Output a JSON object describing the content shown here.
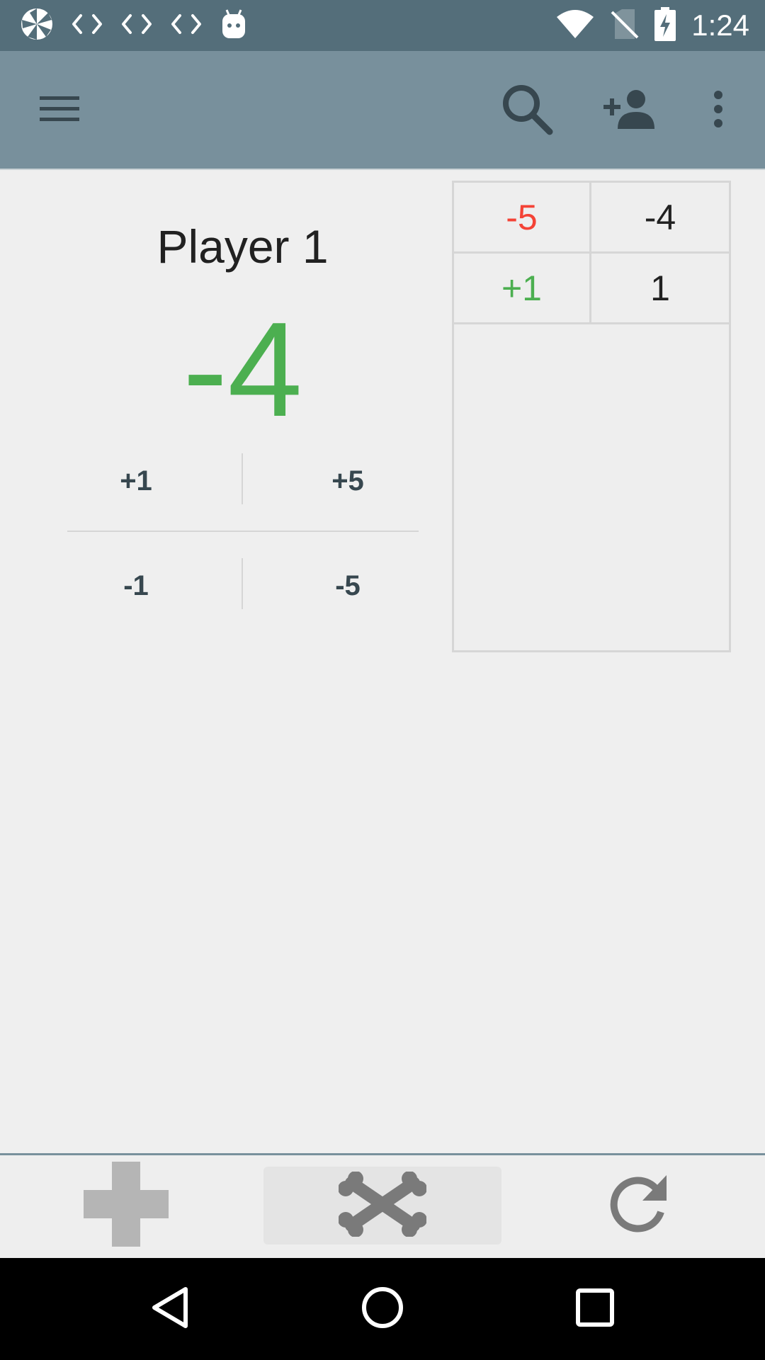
{
  "status_bar": {
    "time": "1:24",
    "left_icons": [
      "app-logo-icon",
      "code-icon",
      "code-icon",
      "code-icon",
      "android-icon"
    ],
    "right_icons": [
      "wifi-icon",
      "no-sim-icon",
      "battery-charging-icon"
    ]
  },
  "app_bar": {
    "icons": [
      "menu-icon",
      "search-icon",
      "add-person-icon",
      "more-vert-icon"
    ]
  },
  "player": {
    "name": "Player 1",
    "score": "-4",
    "score_color": "#4caf50"
  },
  "adjust_buttons": {
    "plus_one": "+1",
    "plus_five": "+5",
    "minus_one": "-1",
    "minus_five": "-5"
  },
  "history": {
    "rows": [
      {
        "delta": "-5",
        "delta_color": "#f44336",
        "total": "-4"
      },
      {
        "delta": "+1",
        "delta_color": "#4caf50",
        "total": "1"
      }
    ]
  },
  "bottom_bar": {
    "icons": [
      "add-icon",
      "crossbones-icon",
      "reset-icon"
    ]
  },
  "nav_bar": {
    "icons": [
      "back-icon",
      "home-icon",
      "recents-icon"
    ]
  },
  "colors": {
    "status_bar": "#546e7a",
    "app_bar": "#78909c",
    "positive": "#4caf50",
    "negative": "#f44336"
  }
}
